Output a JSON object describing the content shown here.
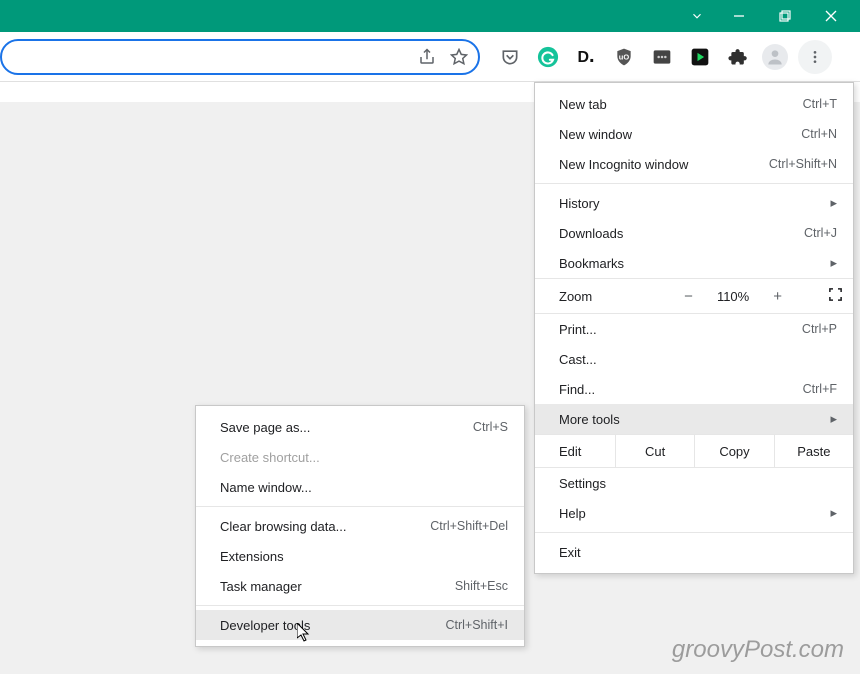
{
  "window_controls": {
    "chevron": "⌄",
    "minimize": "−",
    "maximize": "☐",
    "close": "✕"
  },
  "toolbar": {
    "extensions": [
      "pocket",
      "grammarly",
      "dark",
      "ublock",
      "dots",
      "play",
      "puzzle"
    ]
  },
  "menu": {
    "new_tab": {
      "label": "New tab",
      "shortcut": "Ctrl+T"
    },
    "new_window": {
      "label": "New window",
      "shortcut": "Ctrl+N"
    },
    "new_incognito": {
      "label": "New Incognito window",
      "shortcut": "Ctrl+Shift+N"
    },
    "history": {
      "label": "History"
    },
    "downloads": {
      "label": "Downloads",
      "shortcut": "Ctrl+J"
    },
    "bookmarks": {
      "label": "Bookmarks"
    },
    "zoom": {
      "label": "Zoom",
      "value": "110%"
    },
    "print": {
      "label": "Print...",
      "shortcut": "Ctrl+P"
    },
    "cast": {
      "label": "Cast..."
    },
    "find": {
      "label": "Find...",
      "shortcut": "Ctrl+F"
    },
    "more_tools": {
      "label": "More tools"
    },
    "edit": {
      "label": "Edit",
      "cut": "Cut",
      "copy": "Copy",
      "paste": "Paste"
    },
    "settings": {
      "label": "Settings"
    },
    "help": {
      "label": "Help"
    },
    "exit": {
      "label": "Exit"
    }
  },
  "submenu": {
    "save_page": {
      "label": "Save page as...",
      "shortcut": "Ctrl+S"
    },
    "create_shortcut": {
      "label": "Create shortcut..."
    },
    "name_window": {
      "label": "Name window..."
    },
    "clear_data": {
      "label": "Clear browsing data...",
      "shortcut": "Ctrl+Shift+Del"
    },
    "extensions": {
      "label": "Extensions"
    },
    "task_manager": {
      "label": "Task manager",
      "shortcut": "Shift+Esc"
    },
    "developer_tools": {
      "label": "Developer tools",
      "shortcut": "Ctrl+Shift+I"
    }
  },
  "watermark": "groovyPost.com"
}
